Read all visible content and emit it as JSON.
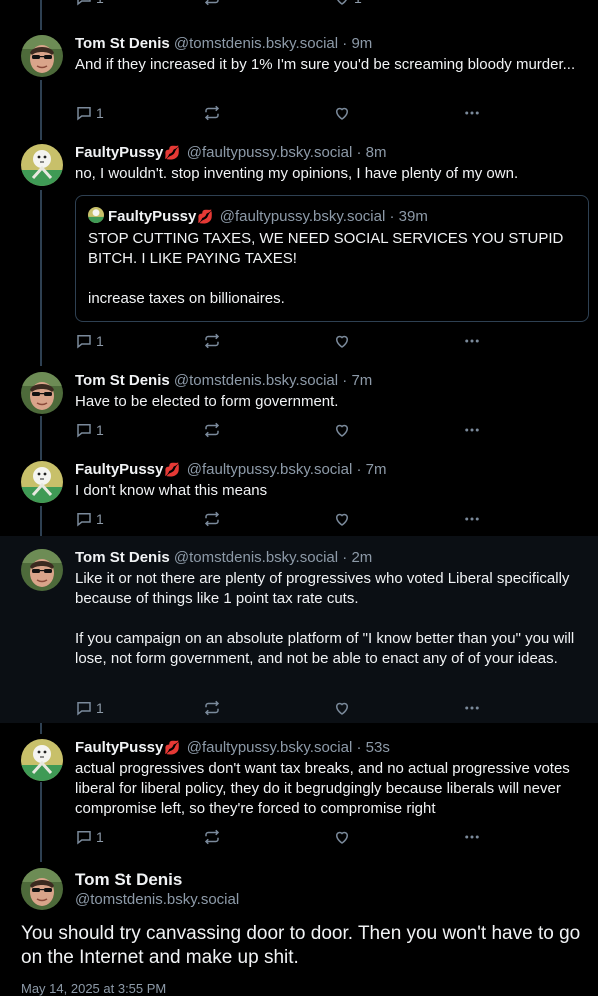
{
  "colors": {
    "background": "#000000",
    "highlight_background": "#0b0f14",
    "text": "#f1f3f5",
    "muted": "#8d9aa8",
    "thread_line": "#2e4052"
  },
  "top_partial": {
    "reply_count": "1",
    "like_count": "1"
  },
  "posts": [
    {
      "name": "Tom St Denis",
      "handle": "@tomstdenis.bsky.social",
      "time": "9m",
      "text": "And if they increased it by 1% I'm sure you'd be screaming bloody murder...",
      "reply_count": "1"
    },
    {
      "name": "FaultyPussy",
      "emoji": "💋",
      "handle": "@faultypussy.bsky.social",
      "time": "8m",
      "text": "no, I wouldn't. stop inventing my opinions, I have plenty of my own.",
      "reply_count": "1",
      "quote": {
        "name": "FaultyPussy",
        "emoji": "💋",
        "handle": "@faultypussy.bsky.social",
        "time": "39m",
        "text": "STOP CUTTING TAXES, WE NEED SOCIAL SERVICES YOU STUPID BITCH. I LIKE PAYING TAXES!\n\nincrease taxes on billionaires."
      }
    },
    {
      "name": "Tom St Denis",
      "handle": "@tomstdenis.bsky.social",
      "time": "7m",
      "text": "Have to be elected to form government.",
      "reply_count": "1"
    },
    {
      "name": "FaultyPussy",
      "emoji": "💋",
      "handle": "@faultypussy.bsky.social",
      "time": "7m",
      "text": "I don't know what this means",
      "reply_count": "1"
    },
    {
      "name": "Tom St Denis",
      "handle": "@tomstdenis.bsky.social",
      "time": "2m",
      "text": "Like it or not there are plenty of progressives who voted Liberal specifically because of things like 1 point tax rate cuts.\n\nIf you campaign on an absolute platform of \"I know better than you\" you will lose, not form government, and not be able to enact any of of your ideas.",
      "reply_count": "1"
    },
    {
      "name": "FaultyPussy",
      "emoji": "💋",
      "handle": "@faultypussy.bsky.social",
      "time": "53s",
      "text": "actual progressives don't want tax breaks, and no actual progressive votes liberal for liberal policy, they do it begrudgingly because liberals will never compromise left, so they're forced to compromise right",
      "reply_count": "1"
    }
  ],
  "main_post": {
    "name": "Tom St Denis",
    "handle": "@tomstdenis.bsky.social",
    "text": "You should try canvassing door to door.  Then you won't have to go on the Internet and make up shit.",
    "date": "May 14, 2025 at 3:55 PM"
  },
  "icons": {
    "reply": "reply-icon",
    "repost": "repost-icon",
    "like": "heart-icon",
    "more": "more-icon"
  }
}
